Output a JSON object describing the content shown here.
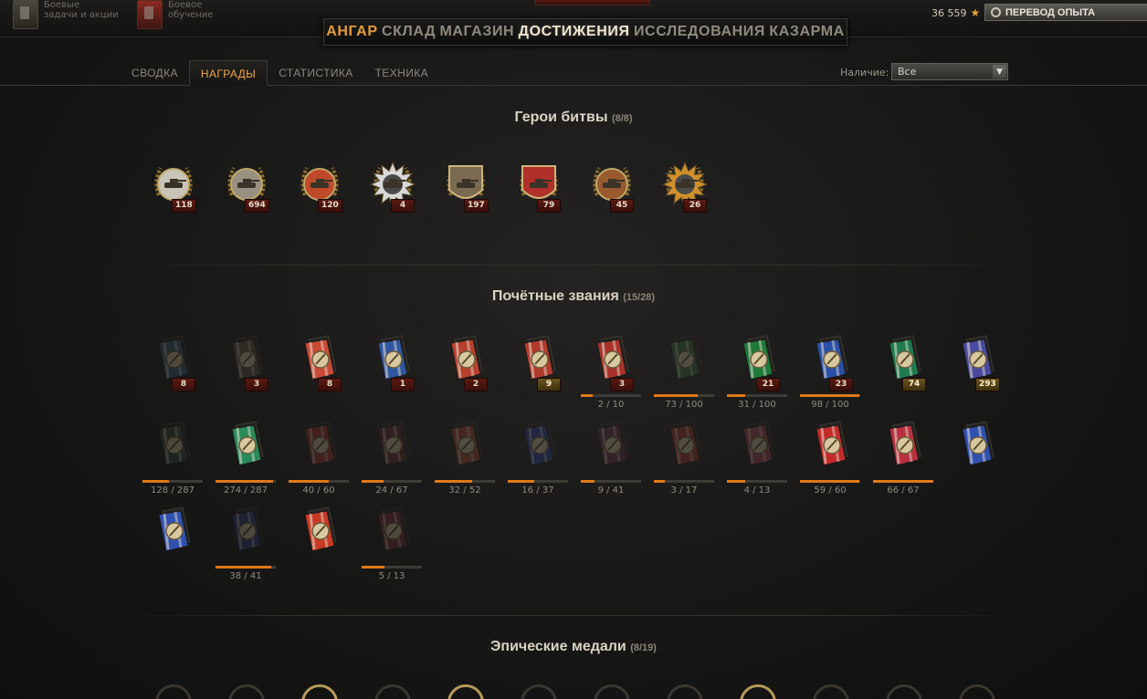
{
  "topbar": {
    "left_items": [
      {
        "line1": "Боевые",
        "line2": "задачи и акции"
      },
      {
        "line1": "Боевое",
        "line2": "обучение"
      }
    ],
    "nav": [
      "АНГАР",
      "СКЛАД",
      "МАГАЗИН",
      "ДОСТИЖЕНИЯ",
      "ИССЛЕДОВАНИЯ",
      "КАЗАРМА"
    ],
    "nav_active": "ДОСТИЖЕНИЯ",
    "credits": "36 559",
    "xp_button": "ПЕРЕВОД ОПЫТА"
  },
  "tabs": [
    "СВОДКА",
    "НАГРАДЫ",
    "СТАТИСТИКА",
    "ТЕХНИКА"
  ],
  "active_tab": "НАГРАДЫ",
  "filter": {
    "label": "Наличие:",
    "value": "Все"
  },
  "sections": {
    "heroes": {
      "title": "Герои битвы",
      "count": "(8/8)",
      "items": [
        {
          "badge": "118",
          "icon": "medal-sword-wreath"
        },
        {
          "badge": "694",
          "icon": "medal-tank-sight"
        },
        {
          "badge": "120",
          "icon": "medal-two-tanks"
        },
        {
          "badge": "4",
          "icon": "medal-silver-star"
        },
        {
          "badge": "197",
          "icon": "medal-shield-tank"
        },
        {
          "badge": "79",
          "icon": "medal-red-banner"
        },
        {
          "badge": "45",
          "icon": "medal-tank-wreath"
        },
        {
          "badge": "26",
          "icon": "medal-sun-tank"
        }
      ]
    },
    "honors": {
      "title": "Почётные звания",
      "count": "(15/28)",
      "rows": [
        [
          {
            "badge": "8",
            "color": "#3e5f78",
            "dim": true
          },
          {
            "badge": "3",
            "color": "#5b5140",
            "dim": true
          },
          {
            "badge": "8",
            "color": "#c94a36"
          },
          {
            "badge": "1",
            "color": "#2f56a0"
          },
          {
            "badge": "2",
            "color": "#b8402c"
          },
          {
            "badge": "9",
            "color": "#b23a2c",
            "gold": true
          },
          {
            "badge": "3",
            "color": "#a8322a",
            "progress": "2 / 10",
            "pct": 0.2
          },
          {
            "color": "#2f6a3a",
            "dim": true,
            "progress": "73 / 100",
            "pct": 0.73
          },
          {
            "badge": "21",
            "color": "#1f7a3a",
            "progress": "31 / 100",
            "pct": 0.31
          },
          {
            "badge": "23",
            "color": "#2a4fa8",
            "progress": "98 / 100",
            "pct": 0.98
          },
          {
            "badge": "74",
            "color": "#1f7a50",
            "gold": true
          },
          {
            "badge": "293",
            "color": "#4a4aa0",
            "gold": true
          }
        ],
        [
          {
            "color": "#3a4a3a",
            "dim": true,
            "progress": "128 / 287",
            "pct": 0.446
          },
          {
            "color": "#2a8a5a",
            "progress": "274 / 287",
            "pct": 0.955
          },
          {
            "color": "#a83028",
            "dim": true,
            "progress": "40 / 60",
            "pct": 0.667
          },
          {
            "color": "#6a2a30",
            "dim": true,
            "progress": "24 / 67",
            "pct": 0.358
          },
          {
            "color": "#a84a2a",
            "dim": true,
            "progress": "32 / 52",
            "pct": 0.615
          },
          {
            "color": "#3040a0",
            "dim": true,
            "progress": "16 / 37",
            "pct": 0.432
          },
          {
            "color": "#6a3040",
            "dim": true,
            "progress": "9 / 41",
            "pct": 0.22
          },
          {
            "color": "#a83028",
            "dim": true,
            "progress": "3 / 17",
            "pct": 0.176
          },
          {
            "color": "#a84050",
            "dim": true,
            "progress": "4 / 13",
            "pct": 0.308
          },
          {
            "color": "#c42a2a",
            "progress": "59 / 60",
            "pct": 0.983
          },
          {
            "color": "#b83040",
            "progress": "66 / 67",
            "pct": 1.0
          },
          {
            "color": "#3050b0"
          }
        ],
        [
          {
            "color": "#3050b0"
          },
          {
            "color": "#303a80",
            "dim": true,
            "progress": "38 / 41",
            "pct": 0.927
          },
          {
            "color": "#c83a24"
          },
          {
            "color": "#7a2a30",
            "dim": true,
            "progress": "5 / 13",
            "pct": 0.385
          }
        ]
      ]
    },
    "epic": {
      "title": "Эпические медали",
      "count": "(8/19)"
    }
  }
}
